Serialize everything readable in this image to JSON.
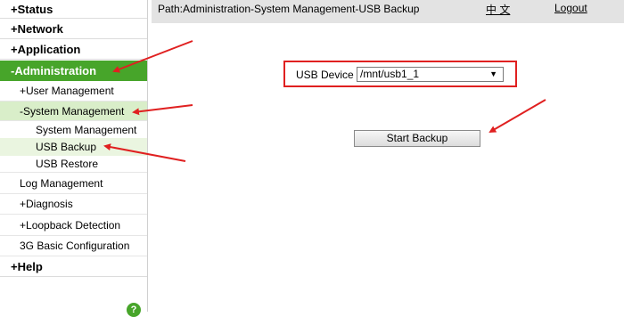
{
  "sidebar": {
    "items": [
      {
        "prefix": "+",
        "label": "Status"
      },
      {
        "prefix": "+",
        "label": "Network"
      },
      {
        "prefix": "+",
        "label": "Application"
      },
      {
        "prefix": "-",
        "label": "Administration"
      },
      {
        "prefix": "+",
        "label": "User Management"
      },
      {
        "prefix": "-",
        "label": "System Management"
      },
      {
        "prefix": "",
        "label": "System Management"
      },
      {
        "prefix": "",
        "label": "USB Backup"
      },
      {
        "prefix": "",
        "label": "USB Restore"
      },
      {
        "prefix": "",
        "label": "Log Management"
      },
      {
        "prefix": "+",
        "label": "Diagnosis"
      },
      {
        "prefix": "+",
        "label": "Loopback Detection"
      },
      {
        "prefix": "",
        "label": "3G Basic Configuration"
      },
      {
        "prefix": "+",
        "label": "Help"
      }
    ],
    "help_icon": "?"
  },
  "header": {
    "path": "Path:Administration-System Management-USB Backup",
    "language": "中 文",
    "logout": "Logout"
  },
  "main": {
    "device_label": "USB Device",
    "device_value": "/mnt/usb1_1",
    "start_button": "Start Backup"
  },
  "colors": {
    "accent": "#47a52a",
    "annotation": "#e02020",
    "topbar": "#e3e3e3"
  }
}
